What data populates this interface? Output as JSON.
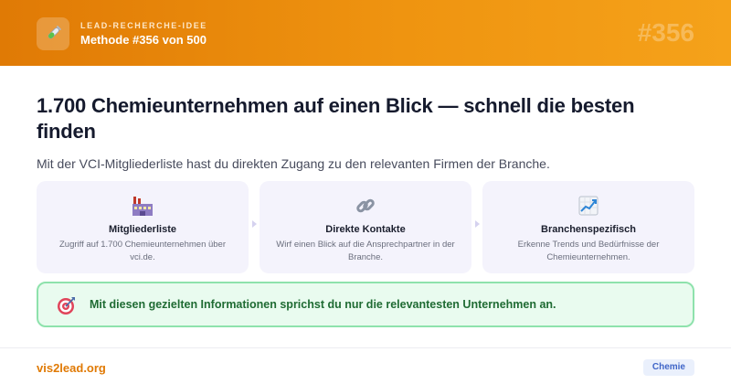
{
  "header": {
    "eyebrow": "LEAD-RECHERCHE-IDEE",
    "method": "Methode #356 von 500",
    "number": "#356",
    "logo_icon": "test-tube-icon"
  },
  "main": {
    "headline": "1.700 Chemieunternehmen auf einen Blick — schnell die besten finden",
    "subline": "Mit der VCI-Mitgliederliste hast du direkten Zugang zu den relevanten Firmen der Branche."
  },
  "cards": [
    {
      "icon": "factory-icon",
      "title": "Mitgliederliste",
      "desc": "Zugriff auf 1.700 Chemieunternehmen über vci.de."
    },
    {
      "icon": "link-icon",
      "title": "Direkte Kontakte",
      "desc": "Wirf einen Blick auf die Ansprechpartner in der Branche."
    },
    {
      "icon": "chart-up-icon",
      "title": "Branchenspezifisch",
      "desc": "Erkenne Trends und Bedürfnisse der Chemieunternehmen."
    }
  ],
  "callout": {
    "icon": "target-icon",
    "text": "Mit diesen gezielten Informationen sprichst du nur die relevantesten Unternehmen an."
  },
  "footer": {
    "brand": "vis2lead.org",
    "tag": "Chemie"
  },
  "colors": {
    "accent": "#e07a05",
    "callout_bg": "#e9fbef",
    "callout_border": "#8ee2ac",
    "card_bg": "#f4f3fc",
    "tag_text": "#3f65c8"
  }
}
